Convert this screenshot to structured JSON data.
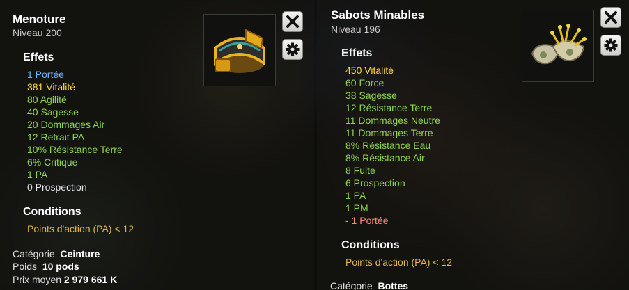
{
  "left": {
    "name": "Menoture",
    "level": "Niveau  200",
    "effects_heading": "Effets",
    "effects": [
      {
        "text": "1 Portée",
        "color": "#6fb4ff"
      },
      {
        "text": "381 Vitalité",
        "color": "#ffd83a"
      },
      {
        "text": "80 Agilité",
        "color": "#8fd44c"
      },
      {
        "text": "40 Sagesse",
        "color": "#8fd44c"
      },
      {
        "text": "20 Dommages Air",
        "color": "#8fd44c"
      },
      {
        "text": "12 Retrait PA",
        "color": "#8fd44c"
      },
      {
        "text": "10% Résistance Terre",
        "color": "#8fd44c"
      },
      {
        "text": "6% Critique",
        "color": "#8fd44c"
      },
      {
        "text": "1 PA",
        "color": "#8fd44c"
      },
      {
        "text": "0 Prospection",
        "color": "#e6e6e6"
      }
    ],
    "conditions_heading": "Conditions",
    "condition": "Points d'action (PA) < 12",
    "category_label": "Catégorie",
    "category_value": "Ceinture",
    "weight_label": "Poids",
    "weight_value": "10 pods",
    "price_label": "Prix moyen",
    "price_value": "2 979 661 K",
    "item_icon": "belt-icon"
  },
  "right": {
    "name": "Sabots Minables",
    "level": "Niveau  196",
    "effects_heading": "Effets",
    "effects": [
      {
        "text": "450 Vitalité",
        "color": "#ffd83a"
      },
      {
        "text": "60 Force",
        "color": "#8fd44c"
      },
      {
        "text": "38 Sagesse",
        "color": "#8fd44c"
      },
      {
        "text": "12 Résistance Terre",
        "color": "#8fd44c"
      },
      {
        "text": "11 Dommages Neutre",
        "color": "#8fd44c"
      },
      {
        "text": "11 Dommages Terre",
        "color": "#8fd44c"
      },
      {
        "text": "8% Résistance Eau",
        "color": "#8fd44c"
      },
      {
        "text": "8% Résistance Air",
        "color": "#8fd44c"
      },
      {
        "text": "8 Fuite",
        "color": "#8fd44c"
      },
      {
        "text": "6 Prospection",
        "color": "#8fd44c"
      },
      {
        "text": "1 PA",
        "color": "#8fd44c"
      },
      {
        "text": "1 PM",
        "color": "#8fd44c"
      },
      {
        "text": "- 1 Portée",
        "color": "#ff8d7a"
      }
    ],
    "conditions_heading": "Conditions",
    "condition": "Points d'action (PA) < 12",
    "category_label": "Catégorie",
    "category_value": "Bottes",
    "item_icon": "boots-icon"
  },
  "buttons": {
    "close_icon": "close-icon",
    "settings_icon": "gear-icon"
  }
}
